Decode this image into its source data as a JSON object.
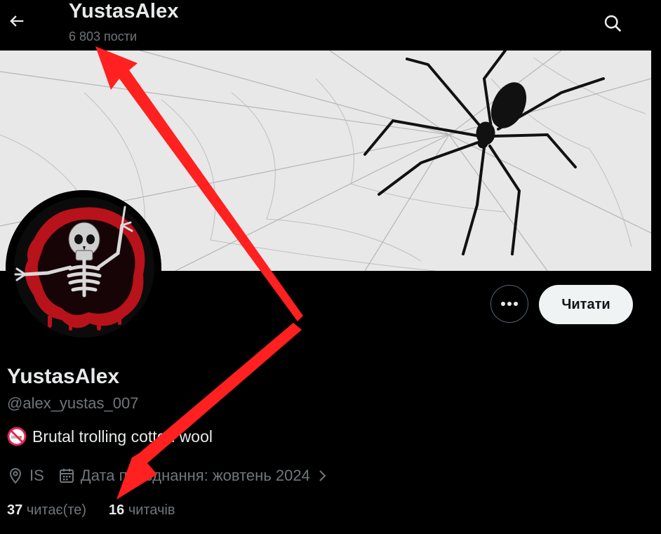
{
  "header": {
    "title": "YustasAlex",
    "posts_count": "6 803 пости"
  },
  "profile": {
    "name": "YustasAlex",
    "handle": "@alex_yustas_007",
    "bio": "Brutal trolling cotton wool",
    "location": "IS",
    "joined": "Дата приєднання: жовтень 2024",
    "following_count": "37",
    "following_label": "читає(те)",
    "followers_count": "16",
    "followers_label": "читачів"
  },
  "actions": {
    "follow_label": "Читати"
  },
  "icons": {
    "back": "arrow-left-icon",
    "search": "search-icon",
    "more": "more-dots-icon",
    "bio_emoji": "no-smoking-emoji",
    "location": "location-pin-icon",
    "calendar": "calendar-icon",
    "chevron": "chevron-right-icon"
  },
  "colors": {
    "background": "#000000",
    "text_primary": "#e7e9ea",
    "text_secondary": "#71767b",
    "button_light": "#eff3f4",
    "annotation_arrow": "#ff2020"
  }
}
